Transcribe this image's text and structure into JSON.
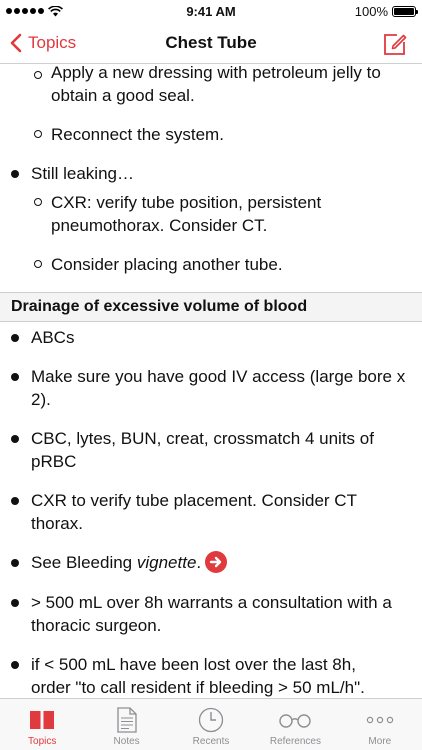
{
  "status_bar": {
    "time": "9:41 AM",
    "battery_text": "100%",
    "battery_level": 1.0,
    "signal_bars": 5,
    "wifi_icon": "wifi-icon"
  },
  "nav": {
    "back_label": "Topics",
    "title": "Chest Tube",
    "compose_icon": "compose-icon"
  },
  "colors": {
    "accent": "#e0393e",
    "tab_inactive": "#8e8e93",
    "section_bg": "#f4f4f4"
  },
  "content": {
    "leak_block": {
      "item_dressing_l1": "Apply a new dressing with petroleum jelly to",
      "item_dressing_l2": "obtain a good seal.",
      "item_reconnect": "Reconnect the system.",
      "still_leaking": "Still leaking…",
      "cxr_l1": "CXR: verify tube position, persistent",
      "cxr_l2": "pneumothorax. Consider CT.",
      "another_tube": "Consider placing another tube."
    },
    "drainage": {
      "header": "Drainage of excessive volume of blood",
      "abcs": "ABCs",
      "iv_l1": "Make sure you have good IV access (large bore x",
      "iv_l2": "2).",
      "cbc_l1": "CBC, lytes, BUN, creat, crossmatch 4 units of",
      "cbc_l2": "pRBC",
      "cxr_l1": "CXR to verify tube placement. Consider CT",
      "cxr_l2": "thorax.",
      "see_prefix": "See Bleeding ",
      "see_link": "vignette",
      "see_suffix": ".",
      "volume_l1": "> 500 mL over 8h warrants a consultation with a",
      "volume_l2": "thoracic surgeon.",
      "lost_l1": "if < 500 mL have been lost over the last 8h,",
      "lost_l2": "order \"to call resident if bleeding > 50 mL/h\"."
    }
  },
  "tabs": [
    {
      "label": "Topics",
      "icon": "book-icon",
      "active": true
    },
    {
      "label": "Notes",
      "icon": "notes-icon",
      "active": false
    },
    {
      "label": "Recents",
      "icon": "clock-icon",
      "active": false
    },
    {
      "label": "References",
      "icon": "glasses-icon",
      "active": false
    },
    {
      "label": "More",
      "icon": "more-icon",
      "active": false
    }
  ]
}
